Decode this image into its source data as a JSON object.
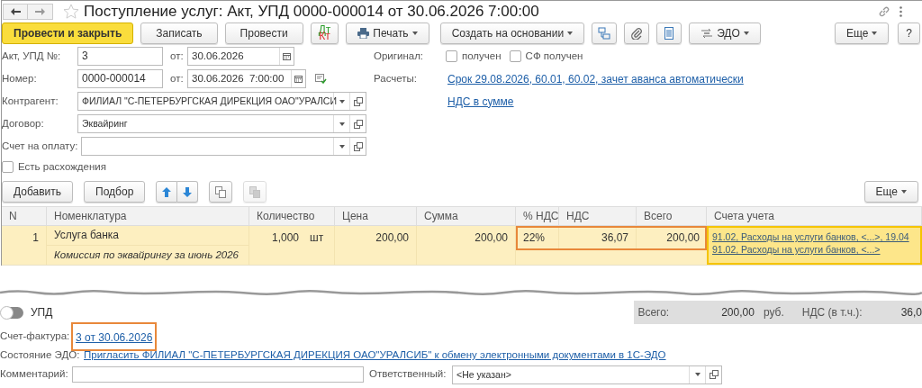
{
  "window": {
    "title": "Поступление услуг: Акт, УПД 0000-000014 от 30.06.2026 7:00:00"
  },
  "toolbar": [
    {
      "kind": "primary",
      "label": "Провести и закрыть"
    },
    {
      "kind": "button",
      "label": "Записать"
    },
    {
      "kind": "button",
      "label": "Провести"
    },
    {
      "kind": "dtkt",
      "label": "Дт",
      "label2": "Кт"
    },
    {
      "kind": "print",
      "label": "Печать"
    },
    {
      "kind": "menu",
      "label": "Создать на основании"
    },
    {
      "kind": "structure"
    },
    {
      "kind": "attach"
    },
    {
      "kind": "document"
    },
    {
      "kind": "edo",
      "label": "ЭДО"
    }
  ],
  "toolbar_more": "Еще",
  "toolbar_help": "?",
  "act": {
    "label": "Акт, УПД №:",
    "value": "3",
    "date_label": "от:",
    "date": "30.06.2026"
  },
  "number": {
    "label": "Номер:",
    "value": "0000-000014",
    "date_label": "от:",
    "date": "30.06.2026  7:00:00"
  },
  "counterparty": {
    "label": "Контрагент:",
    "value": "ФИЛИАЛ \"С-ПЕТЕРБУРГСКАЯ ДИРЕКЦИЯ ОАО\"УРАЛСИ"
  },
  "contract": {
    "label": "Договор:",
    "value": "Эквайринг"
  },
  "invoice_for_payment": {
    "label": "Счет на оплату:"
  },
  "discrepancies": {
    "label": "Есть расхождения",
    "checked": false
  },
  "original": {
    "label": "Оригинал:",
    "checks": [
      {
        "label": "получен",
        "checked": false
      },
      {
        "label": "СФ получен",
        "checked": false
      }
    ]
  },
  "settlements": {
    "label": "Расчеты:",
    "link": "Срок 29.08.2026, 60.01, 60.02, зачет аванса автоматически"
  },
  "vat_link": "НДС в сумме",
  "table_toolbar": [
    {
      "kind": "button",
      "label": "Добавить"
    },
    {
      "kind": "button",
      "label": "Подбор"
    },
    {
      "kind": "updown"
    },
    {
      "kind": "copy",
      "disabled": false
    },
    {
      "kind": "paste",
      "disabled": true
    }
  ],
  "table_more": "Еще",
  "table": {
    "columns": [
      "N",
      "Номенклатура",
      "Количество",
      "Цена",
      "Сумма",
      "% НДС",
      "НДС",
      "Всего",
      "Счета учета"
    ],
    "rows": [
      {
        "n": "1",
        "name": "Услуга банка",
        "comment": "Комиссия по эквайрингу за июнь 2026",
        "qty": "1,000",
        "unit": "шт",
        "price": "200,00",
        "sum": "200,00",
        "vat_rate": "22%",
        "vat": "36,07",
        "total": "200,00",
        "accounts": [
          "91.02, Расходы на услуги банков, <...>, 19.04",
          "91.02, Расходы на услуги банков, <...>"
        ],
        "selected": true,
        "highlighted": true
      }
    ]
  },
  "upd": {
    "label": "УПД",
    "on": false
  },
  "totals": {
    "total_label": "Всего:",
    "total": "200,00",
    "currency": "руб.",
    "vat_label": "НДС (в т.ч.):",
    "vat": "36,0"
  },
  "invoice": {
    "label": "Счет-фактура:",
    "link": "3 от 30.06.2026",
    "highlighted": true
  },
  "edo_state": {
    "label": "Состояние ЭДО:",
    "link": "Пригласить ФИЛИАЛ \"С-ПЕТЕРБУРГСКАЯ ДИРЕКЦИЯ ОАО\"УРАЛСИБ\" к обмену электронными документами в 1С-ЭДО"
  },
  "comment": {
    "label": "Комментарий:"
  },
  "responsible": {
    "label": "Ответственный:",
    "value": "<Не указан>"
  }
}
